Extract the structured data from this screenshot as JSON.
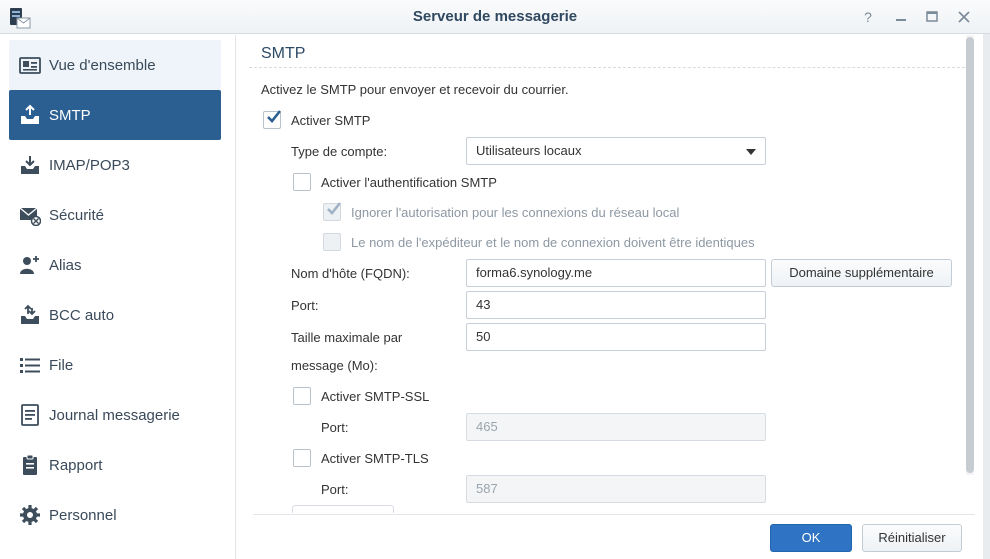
{
  "window": {
    "title": "Serveur de messagerie"
  },
  "sidebar": {
    "items": [
      {
        "label": "Vue d'ensemble",
        "icon": "overview-icon"
      },
      {
        "label": "SMTP",
        "icon": "smtp-inbox-icon"
      },
      {
        "label": "IMAP/POP3",
        "icon": "imap-download-icon"
      },
      {
        "label": "Sécurité",
        "icon": "mail-security-icon"
      },
      {
        "label": "Alias",
        "icon": "alias-users-icon"
      },
      {
        "label": "BCC auto",
        "icon": "bcc-tray-icon"
      },
      {
        "label": "File",
        "icon": "queue-list-icon"
      },
      {
        "label": "Journal messagerie",
        "icon": "log-icon"
      },
      {
        "label": "Rapport",
        "icon": "report-icon"
      },
      {
        "label": "Personnel",
        "icon": "gear-icon"
      }
    ]
  },
  "smtp": {
    "title": "SMTP",
    "description": "Activez le SMTP pour envoyer et recevoir du courrier.",
    "enable_label": "Activer SMTP",
    "enable_checked": true,
    "account_type_label": "Type de compte:",
    "account_type_value": "Utilisateurs locaux",
    "auth_label": "Activer l'authentification SMTP",
    "auth_checked": false,
    "ignore_local_label": "Ignorer l'autorisation pour les connexions du réseau local",
    "ignore_local_checked": true,
    "same_name_label": "Le nom de l'expéditeur et le nom de connexion doivent être identiques",
    "same_name_checked": false,
    "hostname_label": "Nom d'hôte (FQDN):",
    "hostname_value": "forma6.synology.me",
    "extra_domain_button": "Domaine supplémentaire",
    "port_label": "Port:",
    "port_value": "43",
    "max_size_label_line1": "Taille maximale par",
    "max_size_label_line2": "message (Mo):",
    "max_size_value": "50",
    "ssl_label": "Activer SMTP-SSL",
    "ssl_checked": false,
    "ssl_port_label": "Port:",
    "ssl_port_value": "465",
    "tls_label": "Activer SMTP-TLS",
    "tls_checked": false,
    "tls_port_label": "Port:",
    "tls_port_value": "587"
  },
  "footer": {
    "ok_label": "OK",
    "reset_label": "Réinitialiser"
  },
  "colors": {
    "accent": "#2b5f92",
    "primary_button": "#2f74c4",
    "heading": "#2c4a66"
  }
}
